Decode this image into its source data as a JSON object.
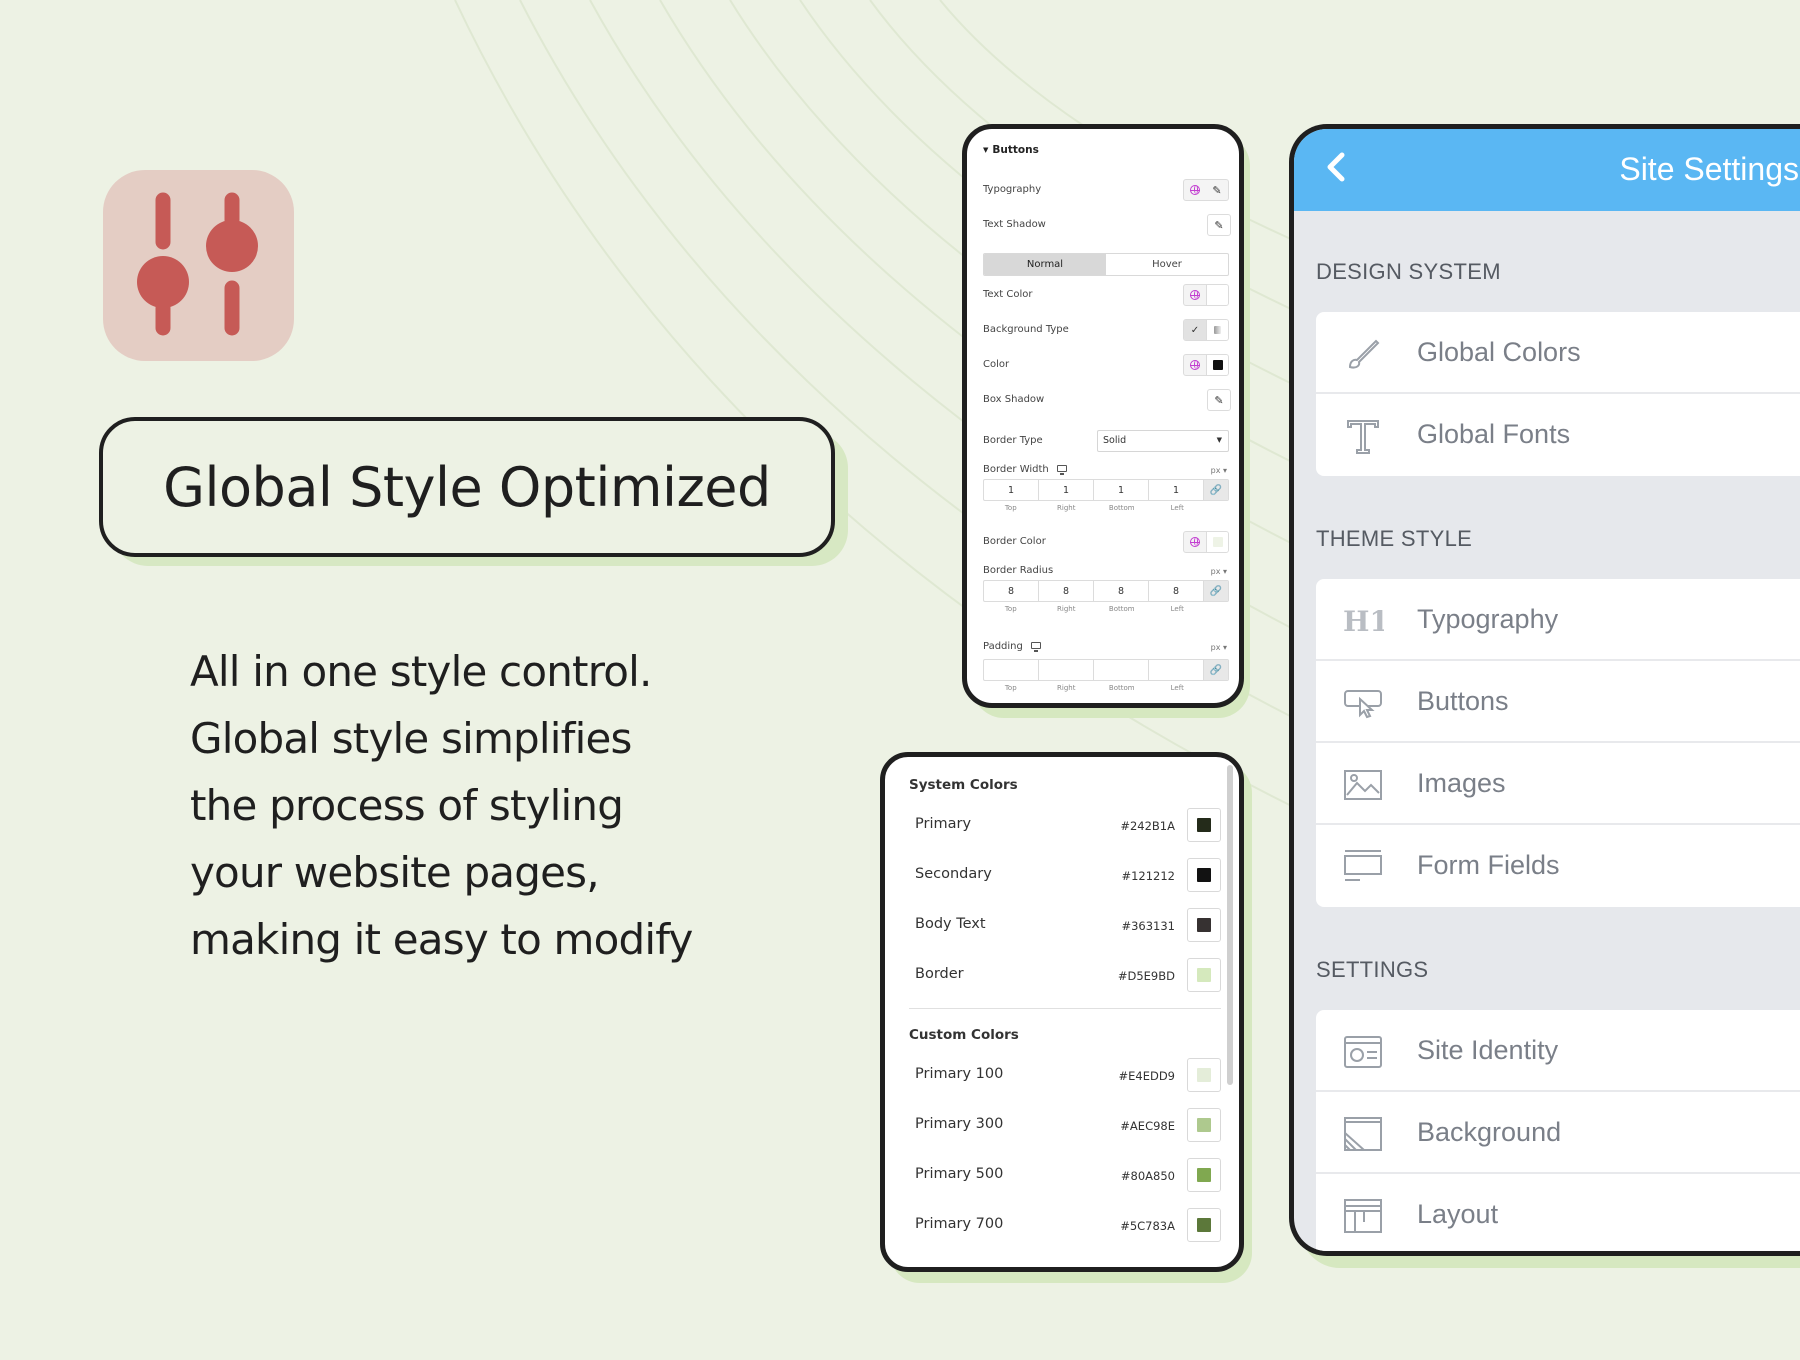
{
  "headline": "Global Style Optimized",
  "description": [
    "All in one style control.",
    "Global style simplifies",
    "the process of styling",
    "your website pages,",
    "making it easy to modify"
  ],
  "buttons_panel": {
    "title": "Buttons",
    "typography": "Typography",
    "text_shadow": "Text Shadow",
    "tab_normal": "Normal",
    "tab_hover": "Hover",
    "text_color": "Text Color",
    "background_type": "Background Type",
    "color": "Color",
    "box_shadow": "Box Shadow",
    "border_type": "Border Type",
    "border_type_value": "Solid",
    "border_width": "Border Width",
    "border_width_unit": "px",
    "border_width_values": [
      "1",
      "1",
      "1",
      "1"
    ],
    "dim_labels": [
      "Top",
      "Right",
      "Bottom",
      "Left"
    ],
    "border_color": "Border Color",
    "border_radius": "Border Radius",
    "border_radius_unit": "px",
    "border_radius_values": [
      "8",
      "8",
      "8",
      "8"
    ],
    "padding": "Padding",
    "padding_unit": "px",
    "padding_values": [
      "",
      "",
      "",
      ""
    ]
  },
  "colors_panel": {
    "system_heading": "System Colors",
    "system_colors": [
      {
        "name": "Primary",
        "hex": "#242B1A",
        "color": "#242B1A"
      },
      {
        "name": "Secondary",
        "hex": "#121212",
        "color": "#121212"
      },
      {
        "name": "Body Text",
        "hex": "#363131",
        "color": "#363131"
      },
      {
        "name": "Border",
        "hex": "#D5E9BD",
        "color": "#D5E9BD"
      }
    ],
    "custom_heading": "Custom Colors",
    "custom_colors": [
      {
        "name": "Primary 100",
        "hex": "#E4EDD9",
        "color": "#E4EDD9"
      },
      {
        "name": "Primary 300",
        "hex": "#AEC98E",
        "color": "#AEC98E"
      },
      {
        "name": "Primary 500",
        "hex": "#80A850",
        "color": "#80A850"
      },
      {
        "name": "Primary 700",
        "hex": "#5C783A",
        "color": "#5C783A"
      }
    ]
  },
  "site_settings": {
    "title": "Site Settings",
    "sections": [
      {
        "heading": "DESIGN SYSTEM",
        "items": [
          {
            "label": "Global Colors",
            "icon": "brush-icon"
          },
          {
            "label": "Global Fonts",
            "icon": "text-t-icon"
          }
        ]
      },
      {
        "heading": "THEME STYLE",
        "items": [
          {
            "label": "Typography",
            "icon": "h1-icon"
          },
          {
            "label": "Buttons",
            "icon": "button-cursor-icon"
          },
          {
            "label": "Images",
            "icon": "image-icon"
          },
          {
            "label": "Form Fields",
            "icon": "form-field-icon"
          }
        ]
      },
      {
        "heading": "SETTINGS",
        "items": [
          {
            "label": "Site Identity",
            "icon": "id-card-icon"
          },
          {
            "label": "Background",
            "icon": "background-icon"
          },
          {
            "label": "Layout",
            "icon": "layout-icon"
          }
        ]
      }
    ]
  },
  "colors": {
    "background": "#edf2e4",
    "accent_green": "#d6e8c0",
    "header_blue": "#5ab7f3",
    "icon_red": "#c65a56",
    "icon_tile": "#e4cdc4"
  }
}
